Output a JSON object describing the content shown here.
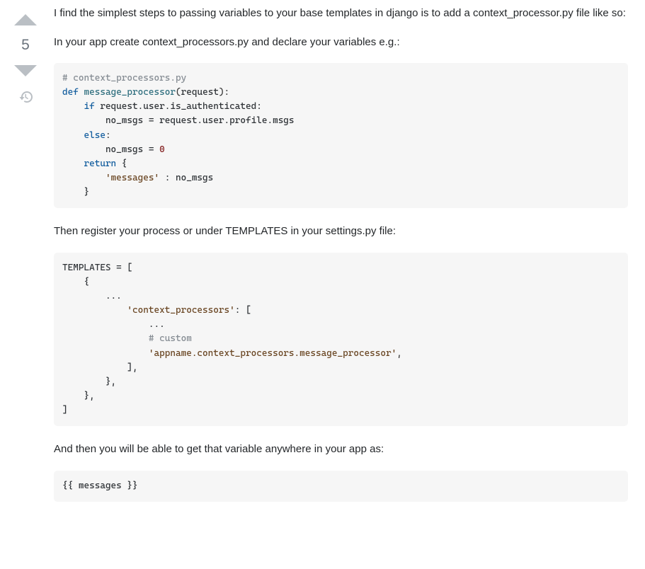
{
  "vote": {
    "score": "5"
  },
  "answer": {
    "p1": "I find the simplest steps to passing variables to your base templates in django is to add a context_processor.py file like so:",
    "p2": "In your app create context_processors.py and declare your variables e.g.:",
    "p3": "Then register your process or under TEMPLATES in your settings.py file:",
    "p4": "And then you will be able to get that variable anywhere in your app as:"
  },
  "code1": {
    "l1_comment": "# context_processors.py",
    "l2_def": "def",
    "l2_name": "message_processor",
    "l2_paren_open": "(",
    "l2_arg": "request",
    "l2_paren_close": "):",
    "l3_if": "if",
    "l3_cond": " request.user.is_authenticated:",
    "l4": "        no_msgs = request.user.profile.msgs",
    "l5_else": "else",
    "l5_colon": ":",
    "l6_a": "        no_msgs = ",
    "l6_num": "0",
    "l7_return": "return",
    "l7_b": " {",
    "l8_str": "'messages'",
    "l8_rest": " : no_msgs",
    "l9": "    }"
  },
  "code2": {
    "l1": "TEMPLATES = [",
    "l2": "    {",
    "l3": "        ...",
    "l4_str": "'context_processors'",
    "l4_rest": ": [",
    "l5": "                ...",
    "l6_comment": "# custom",
    "l7_str": "'appname.context_processors.message_processor'",
    "l7_comma": ",",
    "l8": "            ],",
    "l9": "        },",
    "l10": "    },",
    "l11": "]"
  },
  "code3": {
    "l1": "{{ messages }}"
  }
}
